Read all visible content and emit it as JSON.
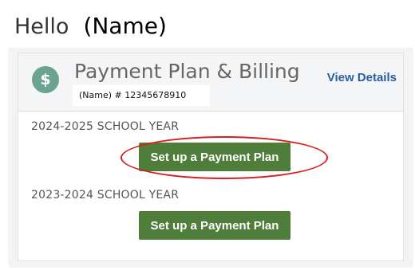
{
  "greeting": {
    "hello": "Hello",
    "name": "(Name)"
  },
  "card": {
    "icon": "dollar-icon",
    "icon_glyph": "$",
    "title": "Payment Plan & Billing",
    "account": "(Name) # 12345678910",
    "view_details_label": "View Details"
  },
  "school_years": [
    {
      "label": "2024-2025 SCHOOL YEAR",
      "button_label": "Set up a Payment Plan"
    },
    {
      "label": "2023-2024 SCHOOL YEAR",
      "button_label": "Set up a Payment Plan"
    }
  ],
  "colors": {
    "button": "#4f7d3a",
    "highlight": "#d62020",
    "link": "#2a5d9f",
    "badge": "#6aa38f"
  }
}
